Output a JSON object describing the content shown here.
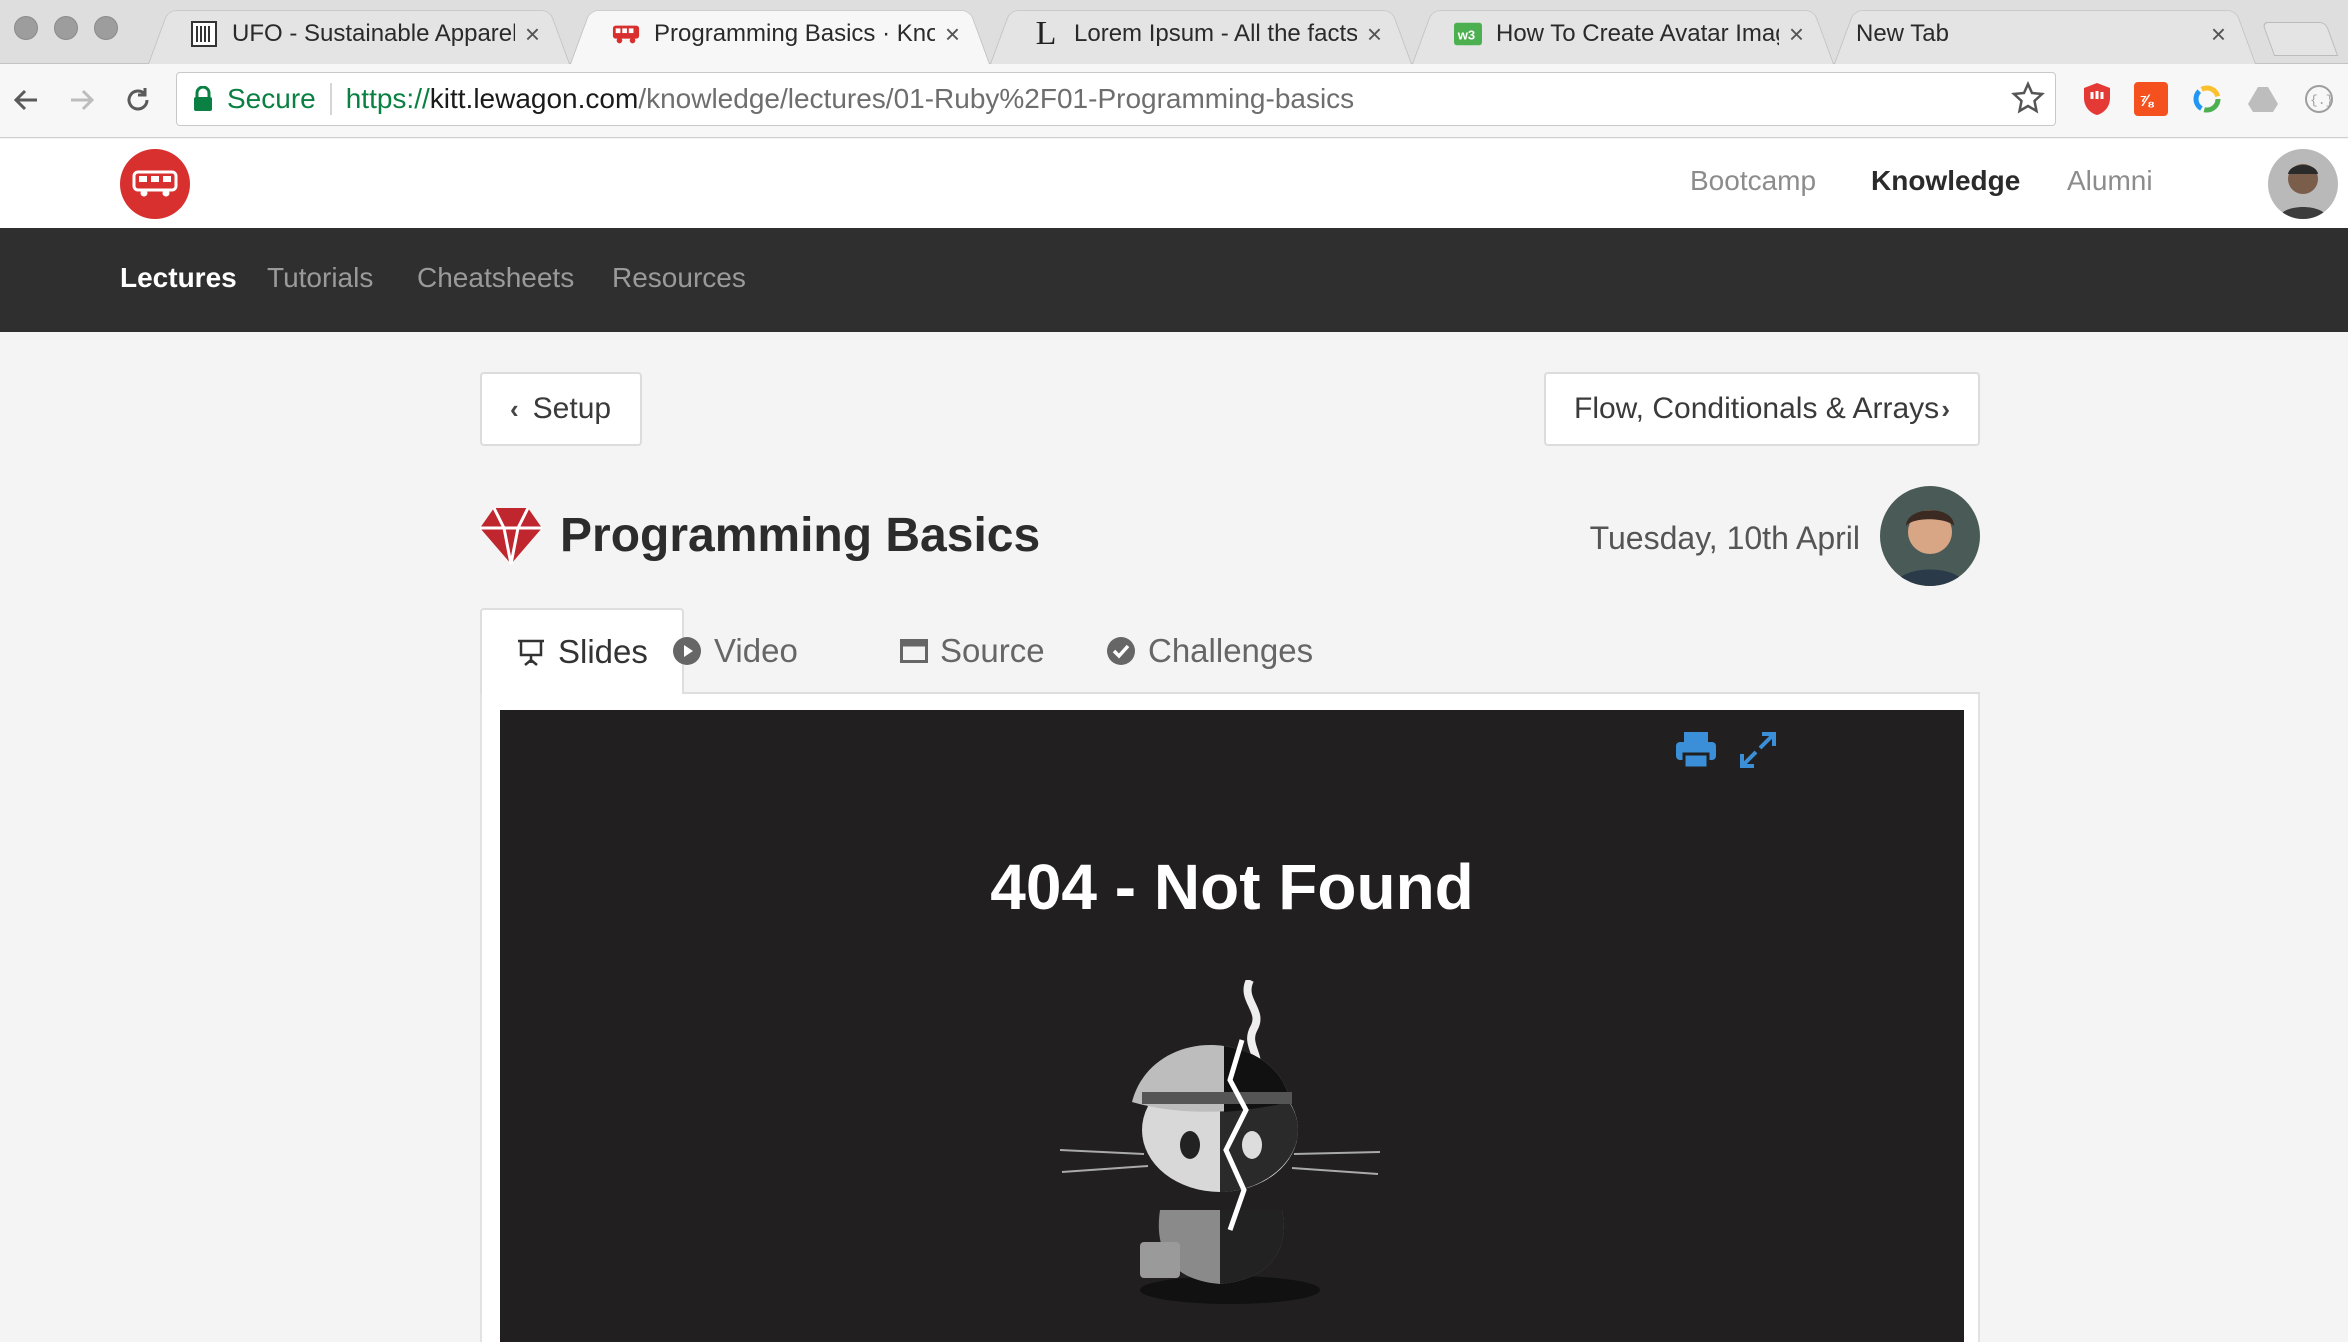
{
  "browser": {
    "tabs": [
      {
        "title": "UFO - Sustainable Apparel",
        "favicon": "ufo-favicon",
        "active": false
      },
      {
        "title": "Programming Basics · Know",
        "favicon": "lewagon-bus-favicon",
        "active": true
      },
      {
        "title": "Lorem Ipsum - All the facts",
        "favicon": "lorem-L-favicon",
        "active": false
      },
      {
        "title": "How To Create Avatar Image",
        "favicon": "w3-favicon",
        "active": false
      },
      {
        "title": "New Tab",
        "favicon": "",
        "active": false
      }
    ],
    "close_glyph": "×",
    "address": {
      "secure_label": "Secure",
      "url_scheme": "https://",
      "url_host": "kitt.lewagon.com",
      "url_path": "/knowledge/lectures/01-Ruby%2F01-Programming-basics"
    }
  },
  "site_header": {
    "nav": [
      "Bootcamp",
      "Knowledge",
      "Alumni"
    ],
    "active_nav": "Knowledge"
  },
  "subnav": {
    "items": [
      "Lectures",
      "Tutorials",
      "Cheatsheets",
      "Resources"
    ],
    "active": "Lectures"
  },
  "lecture": {
    "prev_label": "Setup",
    "next_label": "Flow, Conditionals & Arrays",
    "title": "Programming Basics",
    "date": "Tuesday, 10th April",
    "tabs": [
      "Slides",
      "Video",
      "Source",
      "Challenges"
    ],
    "active_tab": "Slides"
  },
  "slide": {
    "title": "404 - Not Found"
  },
  "colors": {
    "brand_red": "#d8302f",
    "subnav_bg": "#2f2f2f",
    "secure_green": "#0b8043",
    "slide_bg": "#211f1f",
    "tool_blue": "#3a8fd8"
  }
}
